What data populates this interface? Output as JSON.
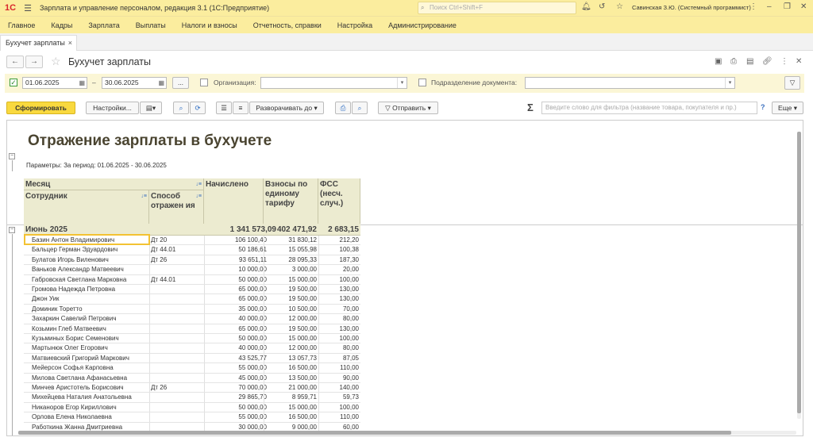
{
  "app": {
    "logo": "1С",
    "title": "Зарплата и управление персоналом, редакция 3.1  (1С:Предприятие)",
    "search_placeholder": "Поиск Ctrl+Shift+F",
    "user": "Савинская З.Ю. (Системный программист)"
  },
  "menu": [
    "Главное",
    "Кадры",
    "Зарплата",
    "Выплаты",
    "Налоги и взносы",
    "Отчетность, справки",
    "Настройка",
    "Администрирование"
  ],
  "tab": {
    "label": "Бухучет зарплаты",
    "close": "×"
  },
  "form": {
    "title": "Бухучет зарплаты",
    "date_from": "01.06.2025",
    "date_dash": "–",
    "date_to": "30.06.2025",
    "period_btn": "...",
    "org_label": "Организация:",
    "org_value": "",
    "dept_label": "Подразделение документа:",
    "dept_value": ""
  },
  "toolbar": {
    "generate": "Сформировать",
    "settings": "Настройки...",
    "expand": "Разворачивать до",
    "send": "Отправить",
    "sigma": "Σ",
    "filter_placeholder": "Введите слово для фильтра (название товара, покупателя и пр.)",
    "help": "?",
    "more": "Еще"
  },
  "report": {
    "title": "Отражение зарплаты в бухучете",
    "params": "Параметры:   За период: 01.06.2025 - 30.06.2025",
    "headers": {
      "month": "Месяц",
      "employee": "Сотрудник",
      "method": "Способ отражен ия",
      "accrued": "Начислено",
      "contrib": "Взносы по единому тарифу",
      "fss": "ФСС (несч. случ.)"
    },
    "group": {
      "name": "Июнь 2025",
      "accrued": "1 341 573,09",
      "contrib": "402 471,92",
      "fss": "2 683,15"
    },
    "rows": [
      {
        "name": "Базин Антон Владимирович",
        "method": "Дт 20",
        "accrued": "106 100,40",
        "contrib": "31 830,12",
        "fss": "212,20"
      },
      {
        "name": "Бальцер Герман Эдуардович",
        "method": "Дт 44.01",
        "accrued": "50 186,61",
        "contrib": "15 055,98",
        "fss": "100,38"
      },
      {
        "name": "Булатов Игорь Виленович",
        "method": "Дт 26",
        "accrued": "93 651,11",
        "contrib": "28 095,33",
        "fss": "187,30"
      },
      {
        "name": "Ваньков Александр Матвеевич",
        "method": "",
        "accrued": "10 000,00",
        "contrib": "3 000,00",
        "fss": "20,00"
      },
      {
        "name": "Габровская Светлана Марковна",
        "method": "Дт 44.01",
        "accrued": "50 000,00",
        "contrib": "15 000,00",
        "fss": "100,00"
      },
      {
        "name": "Громова Надежда Петровна",
        "method": "",
        "accrued": "65 000,00",
        "contrib": "19 500,00",
        "fss": "130,00"
      },
      {
        "name": "Джон Уик",
        "method": "",
        "accrued": "65 000,00",
        "contrib": "19 500,00",
        "fss": "130,00"
      },
      {
        "name": "Доминик Торетто",
        "method": "",
        "accrued": "35 000,00",
        "contrib": "10 500,00",
        "fss": "70,00"
      },
      {
        "name": "Захаркин Савелий Петрович",
        "method": "",
        "accrued": "40 000,00",
        "contrib": "12 000,00",
        "fss": "80,00"
      },
      {
        "name": "Козьмин Глеб Матвеевич",
        "method": "",
        "accrued": "65 000,00",
        "contrib": "19 500,00",
        "fss": "130,00"
      },
      {
        "name": "Кузьминых Борис Семенович",
        "method": "",
        "accrued": "50 000,00",
        "contrib": "15 000,00",
        "fss": "100,00"
      },
      {
        "name": "Мартынюк Олег Егорович",
        "method": "",
        "accrued": "40 000,00",
        "contrib": "12 000,00",
        "fss": "80,00"
      },
      {
        "name": "Матвиевский Григорий Маркович",
        "method": "",
        "accrued": "43 525,77",
        "contrib": "13 057,73",
        "fss": "87,05"
      },
      {
        "name": "Мейерсон Софья Карповна",
        "method": "",
        "accrued": "55 000,00",
        "contrib": "16 500,00",
        "fss": "110,00"
      },
      {
        "name": "Милова Светлана Афанасьевна",
        "method": "",
        "accrued": "45 000,00",
        "contrib": "13 500,00",
        "fss": "90,00"
      },
      {
        "name": "Минчев Аристотель Борисович",
        "method": "Дт 26",
        "accrued": "70 000,00",
        "contrib": "21 000,00",
        "fss": "140,00"
      },
      {
        "name": "Михейцева Наталия Анатольевна",
        "method": "",
        "accrued": "29 865,70",
        "contrib": "8 959,71",
        "fss": "59,73"
      },
      {
        "name": "Никаноров Егор Кириллович",
        "method": "",
        "accrued": "50 000,00",
        "contrib": "15 000,00",
        "fss": "100,00"
      },
      {
        "name": "Орлова Елена Николаевна",
        "method": "",
        "accrued": "55 000,00",
        "contrib": "16 500,00",
        "fss": "110,00"
      },
      {
        "name": "Работкина Жанна Дмитриевна",
        "method": "",
        "accrued": "30 000,00",
        "contrib": "9 000,00",
        "fss": "60,00"
      }
    ]
  }
}
